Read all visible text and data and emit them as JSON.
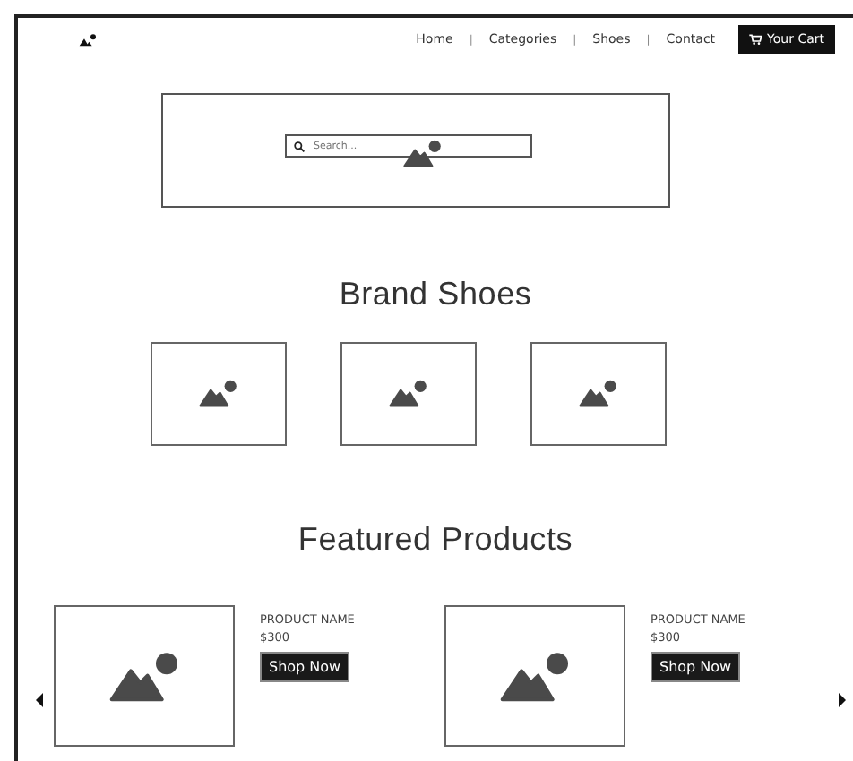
{
  "nav": {
    "items": [
      {
        "kind": "link",
        "label": "Home"
      },
      {
        "kind": "separator",
        "label": "|"
      },
      {
        "kind": "link",
        "label": "Categories"
      },
      {
        "kind": "separator",
        "label": "|"
      },
      {
        "kind": "link",
        "label": "Shoes"
      },
      {
        "kind": "separator",
        "label": "|"
      },
      {
        "kind": "link",
        "label": "Contact"
      }
    ],
    "cart_button": "Your Cart"
  },
  "hero": {
    "search": {
      "placeholder": "Search..."
    }
  },
  "brand_section": {
    "title": "Brand Shoes"
  },
  "featured_section": {
    "title": "Featured Products",
    "products": [
      {
        "name": "PRODUCT NAME",
        "price": "$300",
        "button": "Shop Now"
      },
      {
        "name": "PRODUCT NAME",
        "price": "$300",
        "button": "Shop Now"
      }
    ]
  }
}
